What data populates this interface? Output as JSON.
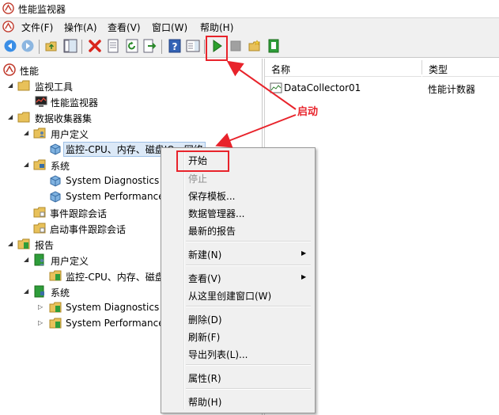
{
  "window": {
    "title": "性能监视器"
  },
  "menu": [
    "文件(F)",
    "操作(A)",
    "查看(V)",
    "窗口(W)",
    "帮助(H)"
  ],
  "tree": [
    {
      "label": "性能",
      "icon": "perf-root-icon",
      "depth": 0,
      "expander": ""
    },
    {
      "label": "监视工具",
      "icon": "folder-icon",
      "depth": 1,
      "expander": "open"
    },
    {
      "label": "性能监视器",
      "icon": "monitor-icon",
      "depth": 2,
      "expander": ""
    },
    {
      "label": "数据收集器集",
      "icon": "folder-icon",
      "depth": 1,
      "expander": "open"
    },
    {
      "label": "用户定义",
      "icon": "folder-user-icon",
      "depth": 2,
      "expander": "open"
    },
    {
      "label": "监控-CPU、内存、磁盘IO、网络",
      "icon": "collector-set-icon",
      "depth": 3,
      "expander": "",
      "selected": true
    },
    {
      "label": "系统",
      "icon": "folder-system-icon",
      "depth": 2,
      "expander": "open"
    },
    {
      "label": "System Diagnostics (",
      "icon": "collector-set-icon",
      "depth": 3,
      "expander": ""
    },
    {
      "label": "System Performance",
      "icon": "collector-set-icon",
      "depth": 3,
      "expander": ""
    },
    {
      "label": "事件跟踪会话",
      "icon": "folder-trace-icon",
      "depth": 2,
      "expander": ""
    },
    {
      "label": "启动事件跟踪会话",
      "icon": "folder-trace-icon",
      "depth": 2,
      "expander": ""
    },
    {
      "label": "报告",
      "icon": "report-folder-icon",
      "depth": 1,
      "expander": "open"
    },
    {
      "label": "用户定义",
      "icon": "report-user-icon",
      "depth": 2,
      "expander": "open"
    },
    {
      "label": "监控-CPU、内存、磁盘",
      "icon": "report-item-icon",
      "depth": 3,
      "expander": ""
    },
    {
      "label": "系统",
      "icon": "report-system-icon",
      "depth": 2,
      "expander": "open"
    },
    {
      "label": "System Diagnostics",
      "icon": "report-item-icon",
      "depth": 3,
      "expander": "closed"
    },
    {
      "label": "System Performance",
      "icon": "report-item-icon",
      "depth": 3,
      "expander": "closed"
    }
  ],
  "list": {
    "columns": [
      "名称",
      "类型"
    ],
    "rows": [
      {
        "name": "DataCollector01",
        "type": "性能计数器"
      }
    ]
  },
  "context_menu": {
    "items": [
      {
        "label": "开始"
      },
      {
        "label": "停止",
        "disabled": true
      },
      {
        "label": "保存模板..."
      },
      {
        "label": "数据管理器..."
      },
      {
        "label": "最新的报告"
      },
      {
        "sep": true
      },
      {
        "label": "新建(N)",
        "submenu": true
      },
      {
        "sep": true
      },
      {
        "label": "查看(V)",
        "submenu": true
      },
      {
        "label": "从这里创建窗口(W)"
      },
      {
        "sep": true
      },
      {
        "label": "删除(D)"
      },
      {
        "label": "刷新(F)"
      },
      {
        "label": "导出列表(L)..."
      },
      {
        "sep": true
      },
      {
        "label": "属性(R)"
      },
      {
        "sep": true
      },
      {
        "label": "帮助(H)"
      }
    ]
  },
  "annotation": {
    "text": "启动",
    "color": "#e8232b"
  }
}
